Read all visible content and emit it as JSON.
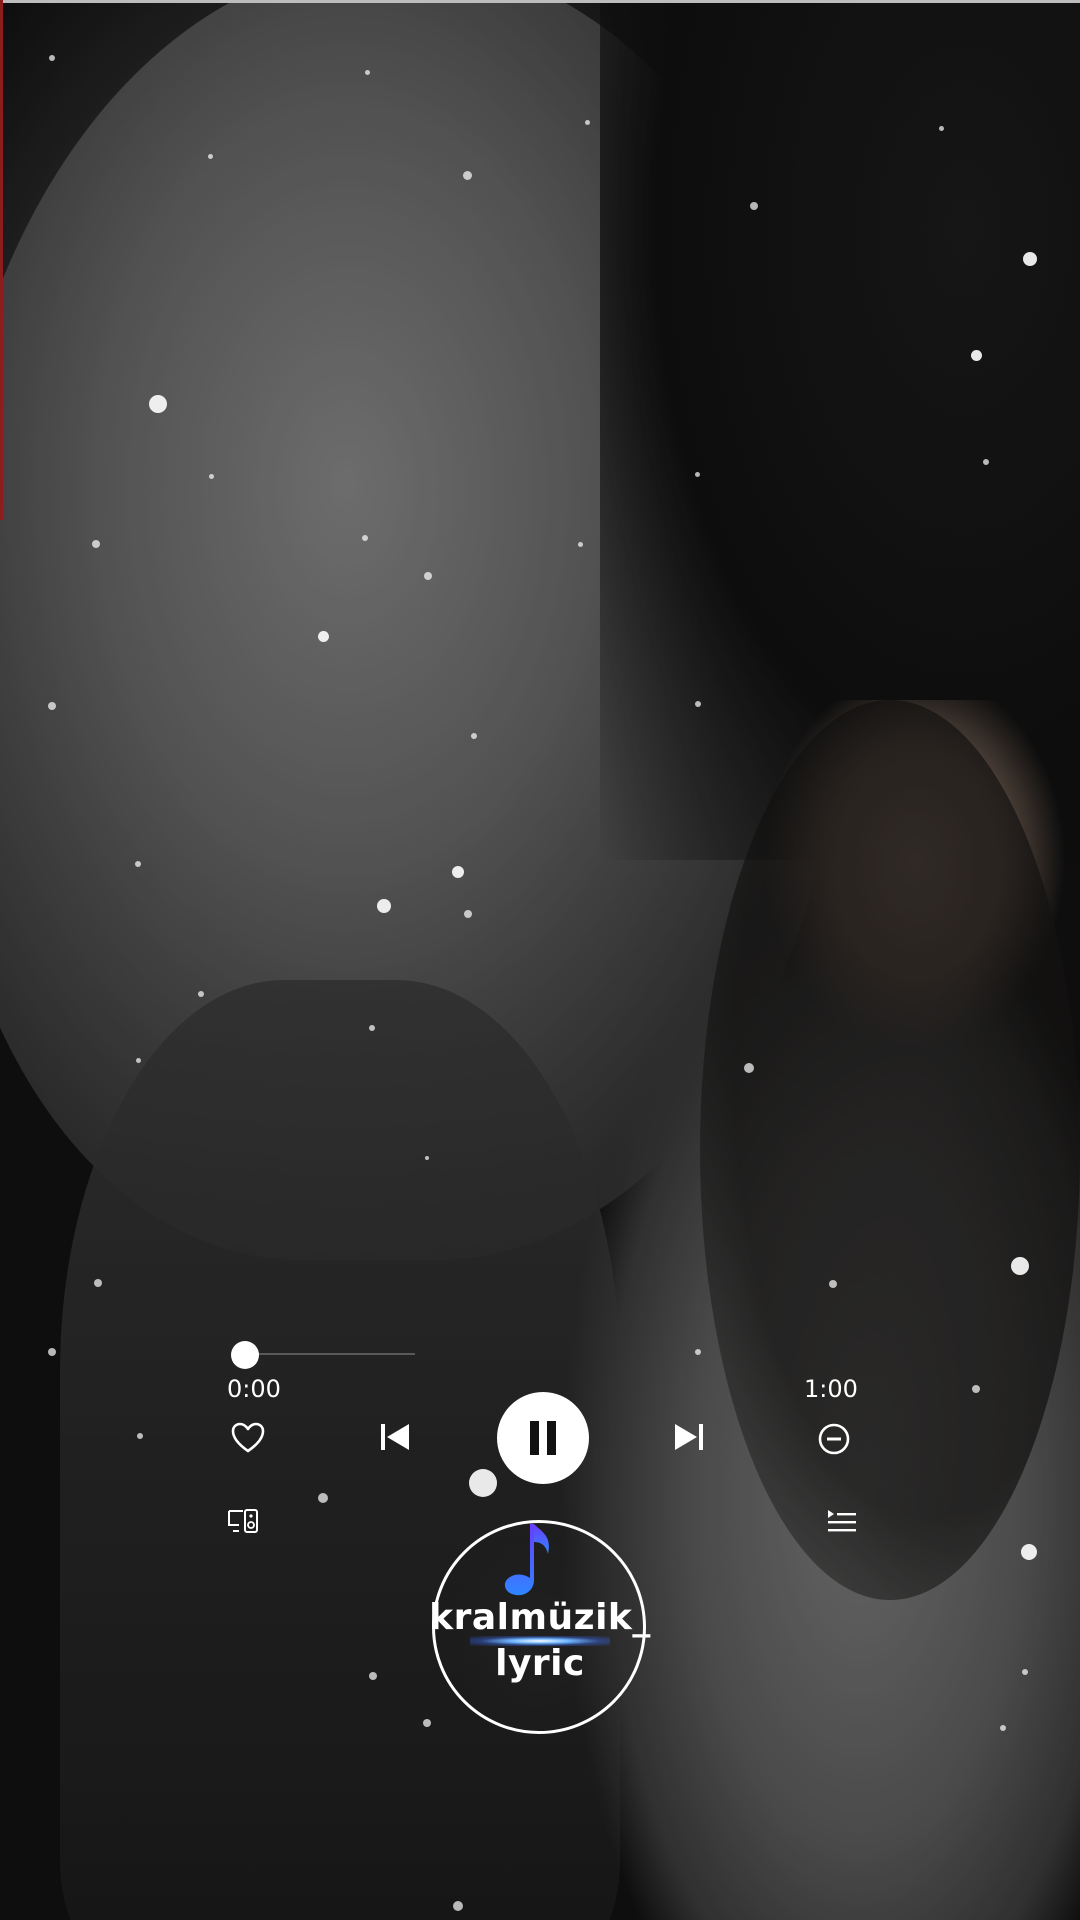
{
  "player": {
    "elapsed": "0:00",
    "total": "1:00",
    "progress_fraction": 0.0,
    "state": "playing"
  },
  "icons": {
    "like": "heart-icon",
    "previous": "skip-previous-icon",
    "pause": "pause-icon",
    "next": "skip-next-icon",
    "remove": "remove-circle-icon",
    "devices": "connect-device-icon",
    "queue": "queue-icon",
    "logo_note": "music-note-icon"
  },
  "logo": {
    "line1": "kralmüzik_",
    "line2": "lyric"
  },
  "colors": {
    "controls": "#ffffff",
    "logo_note": "#3b6cff",
    "logo_glow": "#6fb6ff"
  }
}
